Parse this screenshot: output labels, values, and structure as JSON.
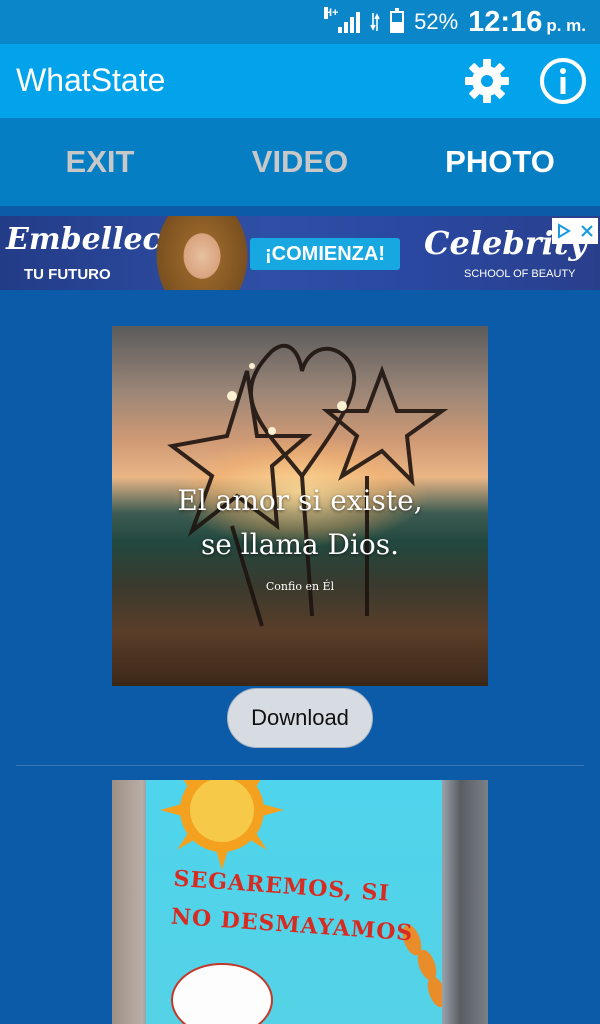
{
  "status_bar": {
    "battery_percent": "52%",
    "time": "12:16",
    "time_suffix": "p. m.",
    "network_type": "H+",
    "battery_level": 0.52
  },
  "app_bar": {
    "title": "WhatState",
    "settings_icon": "gear-icon",
    "info_icon": "info-icon"
  },
  "tabs": [
    {
      "label": "EXIT",
      "active": false
    },
    {
      "label": "VIDEO",
      "active": false
    },
    {
      "label": "PHOTO",
      "active": true
    }
  ],
  "ad": {
    "headline": "Embellece",
    "subline": "TU FUTURO",
    "cta": "¡COMIENZA!",
    "brand": "Celebrity",
    "brand_sub": "SCHOOL OF BEAUTY"
  },
  "feed": {
    "items": [
      {
        "caption_line1": "El amor si existe,",
        "caption_line2": "se llama Dios.",
        "caption_small": "Confio en Él",
        "download_label": "Download"
      },
      {
        "caption_line1": "SEGAREMOS, SI",
        "caption_line2": "NO DESMAYAMOS"
      }
    ]
  },
  "colors": {
    "status_bar": "#0a86c9",
    "app_bar": "#03a3ec",
    "tab_bar": "#057ec4",
    "background": "#0b5ba8",
    "tab_active": "#ffffff",
    "tab_inactive": "#c8c8c8"
  }
}
